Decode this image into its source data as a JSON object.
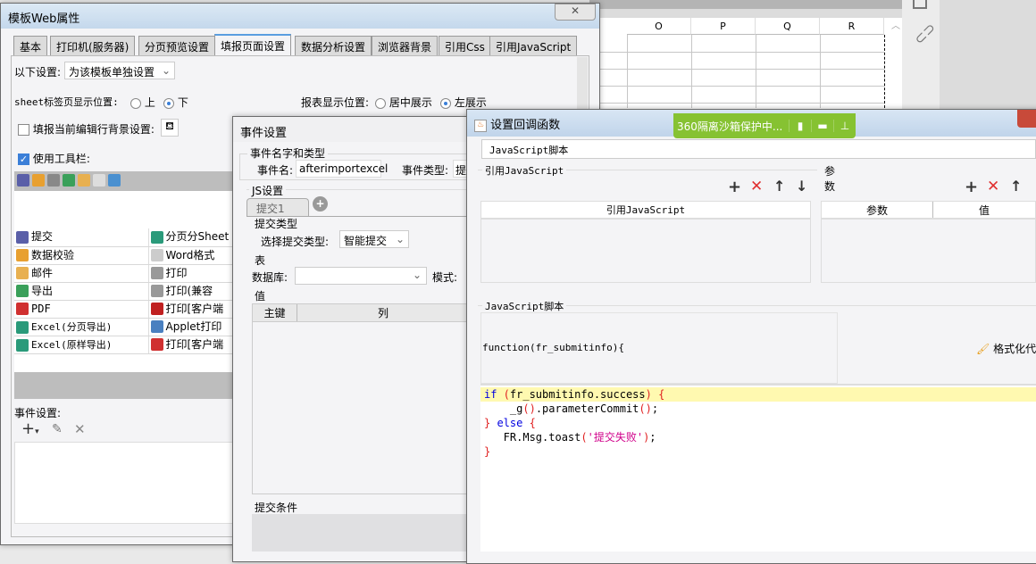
{
  "sheet": {
    "columns": [
      "O",
      "P",
      "Q",
      "R"
    ]
  },
  "web_props": {
    "title": "模板Web属性",
    "tabs": [
      "基本",
      "打印机(服务器)",
      "分页预览设置",
      "填报页面设置",
      "数据分析设置",
      "浏览器背景",
      "引用Css",
      "引用JavaScript"
    ],
    "active_tab": "填报页面设置",
    "setting_label": "以下设置:",
    "setting_value": "为该模板单独设置",
    "sheet_pos_label": "sheet标签页显示位置:",
    "sheet_pos_options": [
      "上",
      "下"
    ],
    "sheet_pos_selected": "下",
    "report_pos_label": "报表显示位置:",
    "report_pos_options": [
      "居中展示",
      "左展示"
    ],
    "report_pos_selected": "左展示",
    "row_bg_label": "填报当前编辑行背景设置:",
    "row_bg_checked": false,
    "toolbar_label": "使用工具栏:",
    "toolbar_checked": true,
    "buttons_left": [
      "提交",
      "数据校验",
      "邮件",
      "导出",
      "PDF",
      "Excel(分页导出)",
      "Excel(原样导出)"
    ],
    "buttons_right": [
      "分页分Sheet",
      "Word格式",
      "打印",
      "打印(兼容",
      "打印[客户端",
      "Applet打印",
      "打印[客户端"
    ],
    "event_label": "事件设置:"
  },
  "event_dialog": {
    "title": "事件设置",
    "group_name": "事件名字和类型",
    "event_name_label": "事件名:",
    "event_name_value": "afterimportexcel",
    "event_type_label": "事件类型:",
    "event_type_value": "提",
    "js_group": "JS设置",
    "js_tab": "提交1",
    "submit_type_group": "提交类型",
    "submit_type_label": "选择提交类型:",
    "submit_type_value": "智能提交",
    "table_group": "表",
    "db_label": "数据库:",
    "mode_label": "模式:",
    "value_group": "值",
    "col_key": "主键",
    "col_col": "列",
    "cond_group": "提交条件"
  },
  "callback_dialog": {
    "title": "设置回调函数",
    "type_value": "JavaScript脚本",
    "ref_group": "引用JavaScript",
    "ref_col": "引用JavaScript",
    "param_group": "参数",
    "param_cols": [
      "参数",
      "值"
    ],
    "script_group": "JavaScript脚本",
    "func_header": "function(fr_submitinfo){",
    "format_btn": "格式化代",
    "code": {
      "l1a": "if",
      "l1b": " (",
      "l1c": "fr_submitinfo.success",
      "l1d": ")",
      "l1e": " {",
      "l2a": "    _g",
      "l2b": "()",
      "l2c": ".parameterCommit",
      "l2d": "()",
      "l2e": ";",
      "l3a": "}",
      "l3b": " else",
      "l3c": " {",
      "l4a": "   FR.Msg.toast",
      "l4b": "(",
      "l4c": "'提交失败'",
      "l4d": ")",
      "l4e": ";",
      "l5": "}"
    }
  },
  "sandbox": {
    "label": "360隔离沙箱保护中..."
  }
}
